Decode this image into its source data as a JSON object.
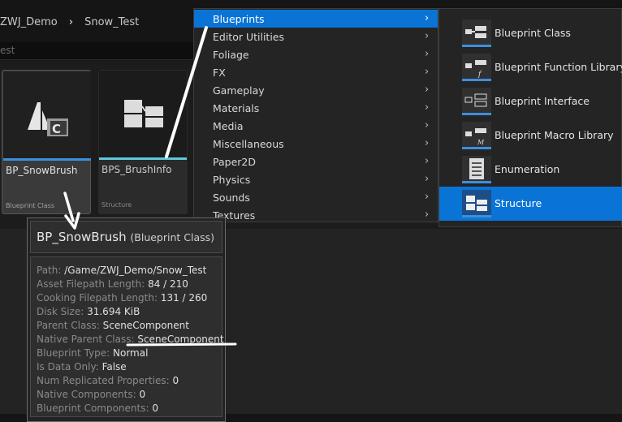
{
  "breadcrumb": [
    "ZWJ_Demo",
    "Snow_Test"
  ],
  "breadcrumb_sep": "›",
  "search": {
    "value": "est"
  },
  "assets": [
    {
      "name": "BP_SnowBrush",
      "type": "Blueprint Class",
      "accent": "#3b8fe0"
    },
    {
      "name": "BPS_BrushInfo",
      "type": "Structure",
      "accent": "#5ec8d8"
    }
  ],
  "menu": {
    "chevron": "›",
    "items": [
      {
        "label": "Blueprints",
        "active": true
      },
      {
        "label": "Editor Utilities"
      },
      {
        "label": "Foliage"
      },
      {
        "label": "FX"
      },
      {
        "label": "Gameplay"
      },
      {
        "label": "Materials"
      },
      {
        "label": "Media"
      },
      {
        "label": "Miscellaneous"
      },
      {
        "label": "Paper2D"
      },
      {
        "label": "Physics"
      },
      {
        "label": "Sounds"
      },
      {
        "label": "Textures"
      }
    ]
  },
  "submenu": {
    "items": [
      {
        "label": "Blueprint Class",
        "icon": "blueprint-class-icon"
      },
      {
        "label": "Blueprint Function Library",
        "icon": "blueprint-function-library-icon",
        "glyph": "f"
      },
      {
        "label": "Blueprint Interface",
        "icon": "blueprint-interface-icon"
      },
      {
        "label": "Blueprint Macro Library",
        "icon": "blueprint-macro-library-icon",
        "glyph": "M"
      },
      {
        "label": "Enumeration",
        "icon": "enumeration-icon"
      },
      {
        "label": "Structure",
        "icon": "structure-icon",
        "active": true
      }
    ]
  },
  "tooltip": {
    "title": "BP_SnowBrush",
    "subtitle": "(Blueprint Class)",
    "rows": [
      {
        "key": "Path:",
        "value": "/Game/ZWJ_Demo/Snow_Test"
      },
      {
        "key": "Asset Filepath Length:",
        "value": "84 / 210"
      },
      {
        "key": "Cooking Filepath Length:",
        "value": "131 / 260"
      },
      {
        "key": "Disk Size:",
        "value": "31.694 KiB"
      },
      {
        "key": "Parent Class:",
        "value": "SceneComponent"
      },
      {
        "key": "Native Parent Class:",
        "value": "SceneComponent"
      },
      {
        "key": "Blueprint Type:",
        "value": "Normal"
      },
      {
        "key": "Is Data Only:",
        "value": "False"
      },
      {
        "key": "Num Replicated Properties:",
        "value": "0"
      },
      {
        "key": "Native Components:",
        "value": "0"
      },
      {
        "key": "Blueprint Components:",
        "value": "0"
      }
    ]
  },
  "colors": {
    "accent_blue": "#0a74d6",
    "blueprint_underline": "#3b8fe0",
    "structure_underline": "#5ec8d8",
    "annotation": "#ffffff"
  }
}
